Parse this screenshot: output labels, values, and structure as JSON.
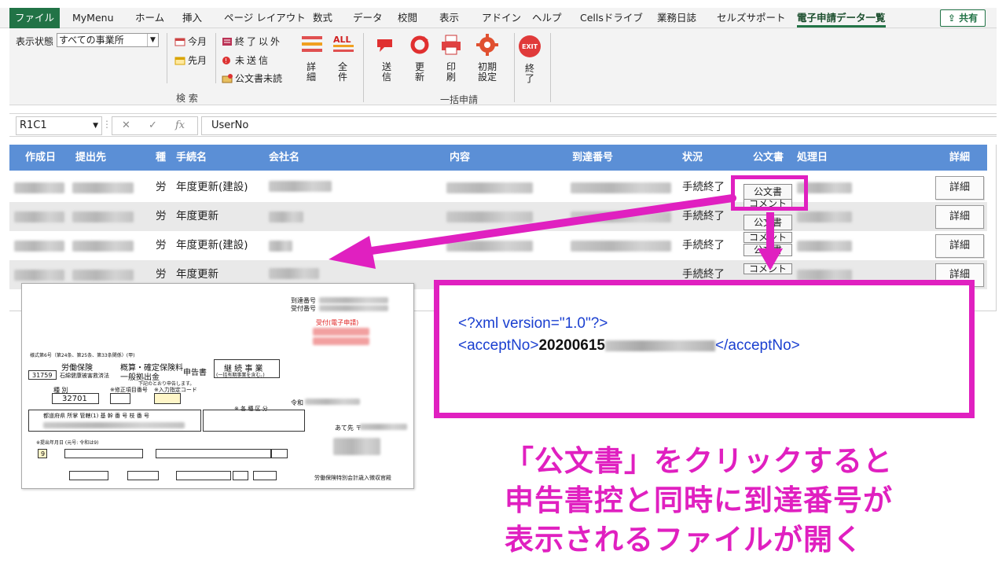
{
  "ribbon_tabs": [
    "ファイル",
    "MyMenu",
    "ホーム",
    "挿入",
    "ページ レイアウト",
    "数式",
    "データ",
    "校閲",
    "表示",
    "アドイン",
    "ヘルプ",
    "Cellsドライブ",
    "業務日誌",
    "セルズサポート",
    "電子申請データ一覧"
  ],
  "share_label": "共有",
  "ribbon": {
    "display_state_label": "表示状態",
    "display_state_value": "すべての事業所",
    "this_month": "今月",
    "last_month": "先月",
    "not_finished": "終了以外",
    "not_sent": "未送信",
    "unreceived_doc": "公文書未読",
    "detail": "詳細",
    "all": "全件",
    "all_icon_text": "ALL",
    "search_group": "検 索",
    "send": "送信",
    "update": "更新",
    "print": "印刷",
    "initial_settings": "初期設定",
    "exit": "終了",
    "exit_icon_text": "EXIT",
    "batch_group": "一括申請"
  },
  "formula_bar": {
    "name_box": "R1C1",
    "formula": "UserNo",
    "fx": "fx"
  },
  "table": {
    "headers": [
      "作成日",
      "提出先",
      "種",
      "手続名",
      "会社名",
      "内容",
      "到達番号",
      "状況",
      "公文書",
      "処理日",
      "詳細"
    ],
    "rows": [
      {
        "type": "労",
        "procedure": "年度更新(建設)",
        "status": "手続終了",
        "doc_label": "公文書",
        "comment_label": "",
        "detail": "詳細"
      },
      {
        "type": "労",
        "procedure": "年度更新",
        "status": "手続終了",
        "doc_label": "公文書",
        "comment_label": "コメント",
        "detail": "詳細"
      },
      {
        "type": "労",
        "procedure": "年度更新(建設)",
        "status": "手続終了",
        "doc_label": "公文書",
        "comment_label": "コメント",
        "detail": "詳細"
      },
      {
        "type": "労",
        "procedure": "年度更新",
        "status": "手続終了",
        "doc_label": "公文書",
        "comment_label": "コメント",
        "detail": "詳細"
      }
    ]
  },
  "document": {
    "arrival_no_label": "到達番号",
    "receipt_no_label": "受付番号",
    "stamp": "受付(電子申請)",
    "form_no": "様式第6号（第24条、第25条、第33条関係）(甲)",
    "insurance": "労働保険",
    "estimate": "概算・確定保険料",
    "general": "一般拠出金",
    "report": "申告書",
    "continuing": "継 続 事 業",
    "continuing_sub": "(一括有期事業を含む。)",
    "code": "31759",
    "code_text": "石綿健康被害救済法",
    "note": "下記のとおり申告します。",
    "kind_label": "種 別",
    "kind_value": "32701",
    "correction": "※修正項目番号",
    "input_code": "※入力指定コード",
    "reiwa": "令和",
    "category": "※ 各 種 区 分",
    "cols": "都道府県 所掌 管轄(1) 基 幹 番 号 枝 番 号",
    "addr": "あて先 〒",
    "date_label": "※提出年月日 (元号: 令和は9)",
    "era_value": "9",
    "office": "労働保険特別会計歳入徴収官殿"
  },
  "xml": {
    "declaration": "<?xml version=\"1.0\"?>",
    "open_tag": "<acceptNo>",
    "value": "20200615",
    "close_tag": "</acceptNo>"
  },
  "caption": {
    "line1": "「公文書」をクリックすると",
    "line2": "申告書控と同時に到達番号が",
    "line3": "表示されるファイルが開く"
  },
  "colors": {
    "excel_green": "#217346",
    "header_blue": "#5b8fd6",
    "highlight_magenta": "#e020c0"
  }
}
